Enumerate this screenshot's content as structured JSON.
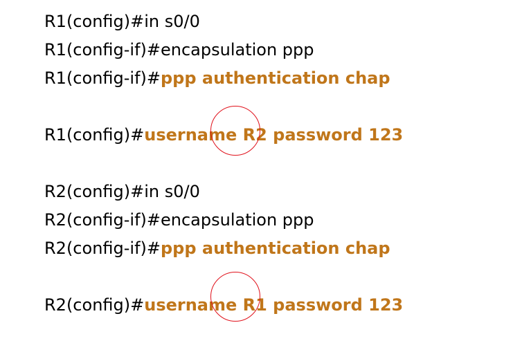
{
  "colors": {
    "text": "#000000",
    "highlight": "#c0761a",
    "circle": "#e0101a",
    "background": "#ffffff"
  },
  "lines": [
    {
      "prompt": "R1(config)#",
      "plain": "in s0/0",
      "highlight": ""
    },
    {
      "prompt": "R1(config-if)#",
      "plain": "encapsulation ppp",
      "highlight": ""
    },
    {
      "prompt": "R1(config-if)#",
      "plain": "",
      "highlight": "ppp authentication chap"
    },
    {
      "prompt": "R1(config)#",
      "plain": "",
      "highlight": "username R2 password 123"
    },
    {
      "prompt": "R2(config)#",
      "plain": "in s0/0",
      "highlight": ""
    },
    {
      "prompt": "R2(config-if)#",
      "plain": "encapsulation ppp",
      "highlight": ""
    },
    {
      "prompt": "R2(config-if)#",
      "plain": "",
      "highlight": "ppp authentication chap"
    },
    {
      "prompt": "R2(config)#",
      "plain": "",
      "highlight": "username R1 password 123"
    }
  ]
}
